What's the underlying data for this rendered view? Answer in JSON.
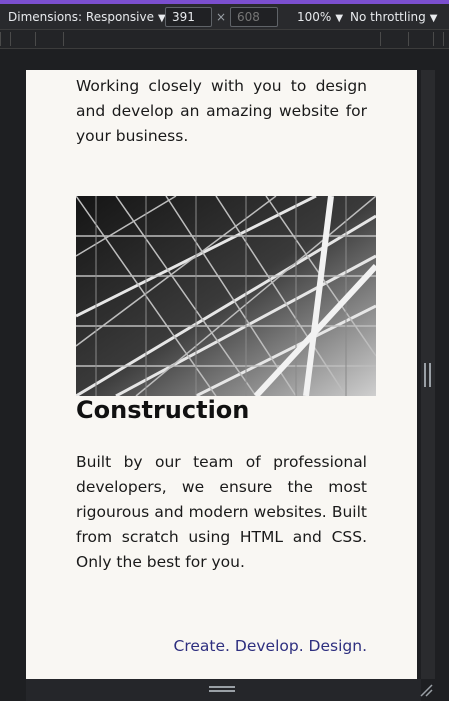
{
  "devtools": {
    "dimensions_label": "Dimensions: Responsive",
    "width_value": "391",
    "times_sign": "×",
    "height_placeholder": "608",
    "zoom_label": "100%",
    "throttling_label": "No throttling",
    "caret": "▼"
  },
  "page": {
    "intro_text": "Working closely with you to design and develop an amazing website for your business.",
    "section_title": "Construction",
    "section_body": "Built by our team of professional developers, we ensure the most rigourous and modern websites. Built from scratch using HTML and CSS. Only the best for you.",
    "tagline": "Create. Develop. Design."
  },
  "colors": {
    "devtools_accent": "#7b4fcf",
    "page_background": "#f9f7f3",
    "tagline_color": "#2e2f7f"
  },
  "icons": {
    "dimensions_caret": "chevron-down-icon",
    "zoom_caret": "chevron-down-icon",
    "throttle_caret": "chevron-down-icon",
    "vertical_resize": "resize-handle-vertical-icon",
    "horizontal_resize": "resize-handle-horizontal-icon",
    "corner_resize": "resize-corner-icon"
  }
}
